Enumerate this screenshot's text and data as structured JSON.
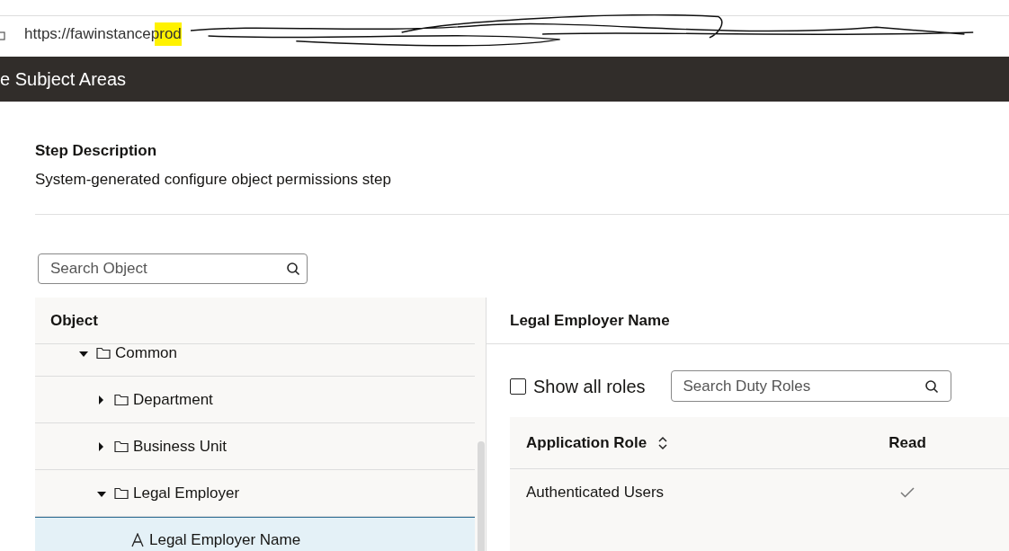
{
  "address_bar": {
    "url": "https://fawinstanceprod"
  },
  "header": {
    "title": "e Subject Areas"
  },
  "step": {
    "heading": "Step Description",
    "description": "System-generated configure object permissions step"
  },
  "object_search": {
    "placeholder": "Search Object"
  },
  "tree": {
    "heading": "Object",
    "items": [
      {
        "label": "Common",
        "kind": "folder",
        "expanded": true,
        "selected": false,
        "children": [
          {
            "label": "Department",
            "kind": "folder",
            "expanded": false,
            "selected": false
          },
          {
            "label": "Business Unit",
            "kind": "folder",
            "expanded": false,
            "selected": false
          },
          {
            "label": "Legal Employer",
            "kind": "folder",
            "expanded": true,
            "selected": false,
            "children": [
              {
                "label": "Legal Employer Name",
                "kind": "attribute",
                "selected": true
              }
            ]
          }
        ]
      }
    ]
  },
  "detail": {
    "title": "Legal Employer Name",
    "show_all_roles": {
      "label": "Show all roles",
      "checked": false
    },
    "role_search": {
      "placeholder": "Search Duty Roles"
    },
    "table": {
      "columns": [
        "Application Role",
        "Read"
      ],
      "rows": [
        {
          "role": "Authenticated Users",
          "read": true
        }
      ]
    }
  }
}
